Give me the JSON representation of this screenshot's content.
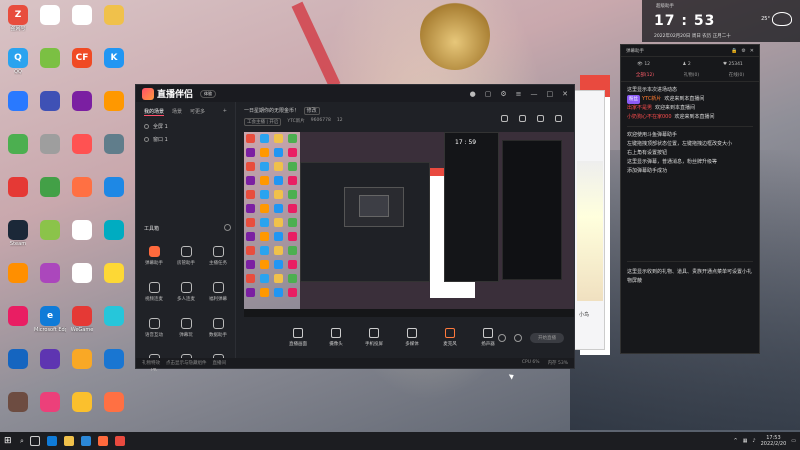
{
  "desktop": {
    "icons": [
      {
        "label": "强网号",
        "color": "#e84d3d",
        "glyph": "Z"
      },
      {
        "label": "",
        "color": "#ffffff",
        "glyph": ""
      },
      {
        "label": "",
        "color": "#ffffff",
        "glyph": ""
      },
      {
        "label": "",
        "color": "#f0c14b",
        "glyph": ""
      },
      {
        "label": "QQ",
        "color": "#2aa3ef",
        "glyph": "Q"
      },
      {
        "label": "",
        "color": "#7bc043",
        "glyph": ""
      },
      {
        "label": "",
        "color": "#f04a24",
        "glyph": "CF"
      },
      {
        "label": "",
        "color": "#2196f3",
        "glyph": "K"
      },
      {
        "label": "",
        "color": "#2979ff",
        "glyph": ""
      },
      {
        "label": "",
        "color": "#3f51b5",
        "glyph": ""
      },
      {
        "label": "",
        "color": "#7b1fa2",
        "glyph": ""
      },
      {
        "label": "",
        "color": "#ff9800",
        "glyph": ""
      },
      {
        "label": "",
        "color": "#4caf50",
        "glyph": ""
      },
      {
        "label": "",
        "color": "#9e9e9e",
        "glyph": ""
      },
      {
        "label": "",
        "color": "#ff5252",
        "glyph": ""
      },
      {
        "label": "",
        "color": "#607d8b",
        "glyph": ""
      },
      {
        "label": "",
        "color": "#e53935",
        "glyph": ""
      },
      {
        "label": "",
        "color": "#43a047",
        "glyph": ""
      },
      {
        "label": "",
        "color": "#ff7043",
        "glyph": ""
      },
      {
        "label": "",
        "color": "#1e88e5",
        "glyph": ""
      },
      {
        "label": "Steam",
        "color": "#1b2838",
        "glyph": ""
      },
      {
        "label": "",
        "color": "#8bc34a",
        "glyph": ""
      },
      {
        "label": "",
        "color": "#ffffff",
        "glyph": ""
      },
      {
        "label": "",
        "color": "#00acc1",
        "glyph": ""
      },
      {
        "label": "",
        "color": "#ff8f00",
        "glyph": ""
      },
      {
        "label": "",
        "color": "#ab47bc",
        "glyph": ""
      },
      {
        "label": "",
        "color": "#ffffff",
        "glyph": ""
      },
      {
        "label": "",
        "color": "#fdd835",
        "glyph": ""
      },
      {
        "label": "",
        "color": "#e91e63",
        "glyph": ""
      },
      {
        "label": "Microsoft Edge",
        "color": "#0f7bd8",
        "glyph": "e"
      },
      {
        "label": "WeGame",
        "color": "#e53935",
        "glyph": ""
      },
      {
        "label": "",
        "color": "#26c6da",
        "glyph": ""
      },
      {
        "label": "",
        "color": "#1565c0",
        "glyph": ""
      },
      {
        "label": "",
        "color": "#5e35b1",
        "glyph": ""
      },
      {
        "label": "",
        "color": "#f9a825",
        "glyph": ""
      },
      {
        "label": "",
        "color": "#1976d2",
        "glyph": ""
      },
      {
        "label": "",
        "color": "#6d4c41",
        "glyph": ""
      },
      {
        "label": "",
        "color": "#ec407a",
        "glyph": ""
      },
      {
        "label": "",
        "color": "#fbc02d",
        "glyph": ""
      },
      {
        "label": "",
        "color": "#ff7043",
        "glyph": ""
      }
    ]
  },
  "app": {
    "name": "直播伴侣",
    "version_badge": "体验",
    "tabs": [
      "我的场景",
      "场景",
      "可更多"
    ],
    "scenes": [
      "全屏 1",
      "窗口 1"
    ],
    "tools_title": "工具箱",
    "tools": [
      {
        "label": "弹幕助手",
        "hot": true
      },
      {
        "label": "房管助手",
        "hot": false
      },
      {
        "label": "主播任务",
        "hot": false
      },
      {
        "label": "视频连麦",
        "hot": false
      },
      {
        "label": "多人连麦",
        "hot": false
      },
      {
        "label": "福利弹幕",
        "hot": false
      },
      {
        "label": "语音互动",
        "hot": false
      },
      {
        "label": "弹幕玩",
        "hot": false
      },
      {
        "label": "数据助手",
        "hot": false
      },
      {
        "label": "PK",
        "hot": false
      },
      {
        "label": "",
        "hot": false
      },
      {
        "label": "",
        "hot": false
      }
    ],
    "room_title": "一日星期你的无限金币！",
    "room_badge": "修改",
    "room_row": [
      "工会主播 | 开启",
      "YTC新片",
      "9606778",
      "12"
    ],
    "controls": [
      "直播画面",
      "摄像头",
      "手机投屏",
      "多媒体",
      "麦克风",
      "扬声器"
    ],
    "go_live": "开始直播",
    "status_left": [
      "礼物特效",
      "点击显示与隐藏组件",
      "直播间"
    ],
    "status_right": [
      "CPU 6%",
      "内存 53%"
    ]
  },
  "panel": {
    "title": "弹幕助手",
    "stats": [
      "12",
      "2",
      "25341"
    ],
    "tabs": [
      "全部(12)",
      "礼物(0)",
      "在线(0)"
    ],
    "system_notice": "这里显示本次进场动态",
    "entries": [
      {
        "tag": "粉丝",
        "name": "YTC新片",
        "color": "orange",
        "text": "欢迎来到本直播间"
      },
      {
        "tag": "",
        "name": "出家不是男",
        "color": "red",
        "text": "欢迎来到本直播间"
      },
      {
        "tag": "",
        "name": "小奶狗心不在家000",
        "color": "red",
        "text": "欢迎来到本直播间"
      }
    ],
    "tips": [
      "欢迎使用斗鱼弹幕助手",
      "左键拖拽顶部状态位置，左键拖拽边框改变大小",
      "右上角有设置按钮",
      "这里显示弹幕，普通消息，粉丝牌升级等",
      "添加弹幕助手成功"
    ],
    "gift_notice": "这里显示收到的礼物、道具、贵族开通点菜单可设置小礼物屏蔽"
  },
  "clock": {
    "label": "超级助手",
    "time": "17 : 53",
    "temp": "25°",
    "date": "2022年02月20日 周日 农历 正月二十"
  },
  "preview": {
    "clock": "17 : 59"
  },
  "taskbar": {
    "time": "17:53",
    "date": "2022/2/20"
  }
}
